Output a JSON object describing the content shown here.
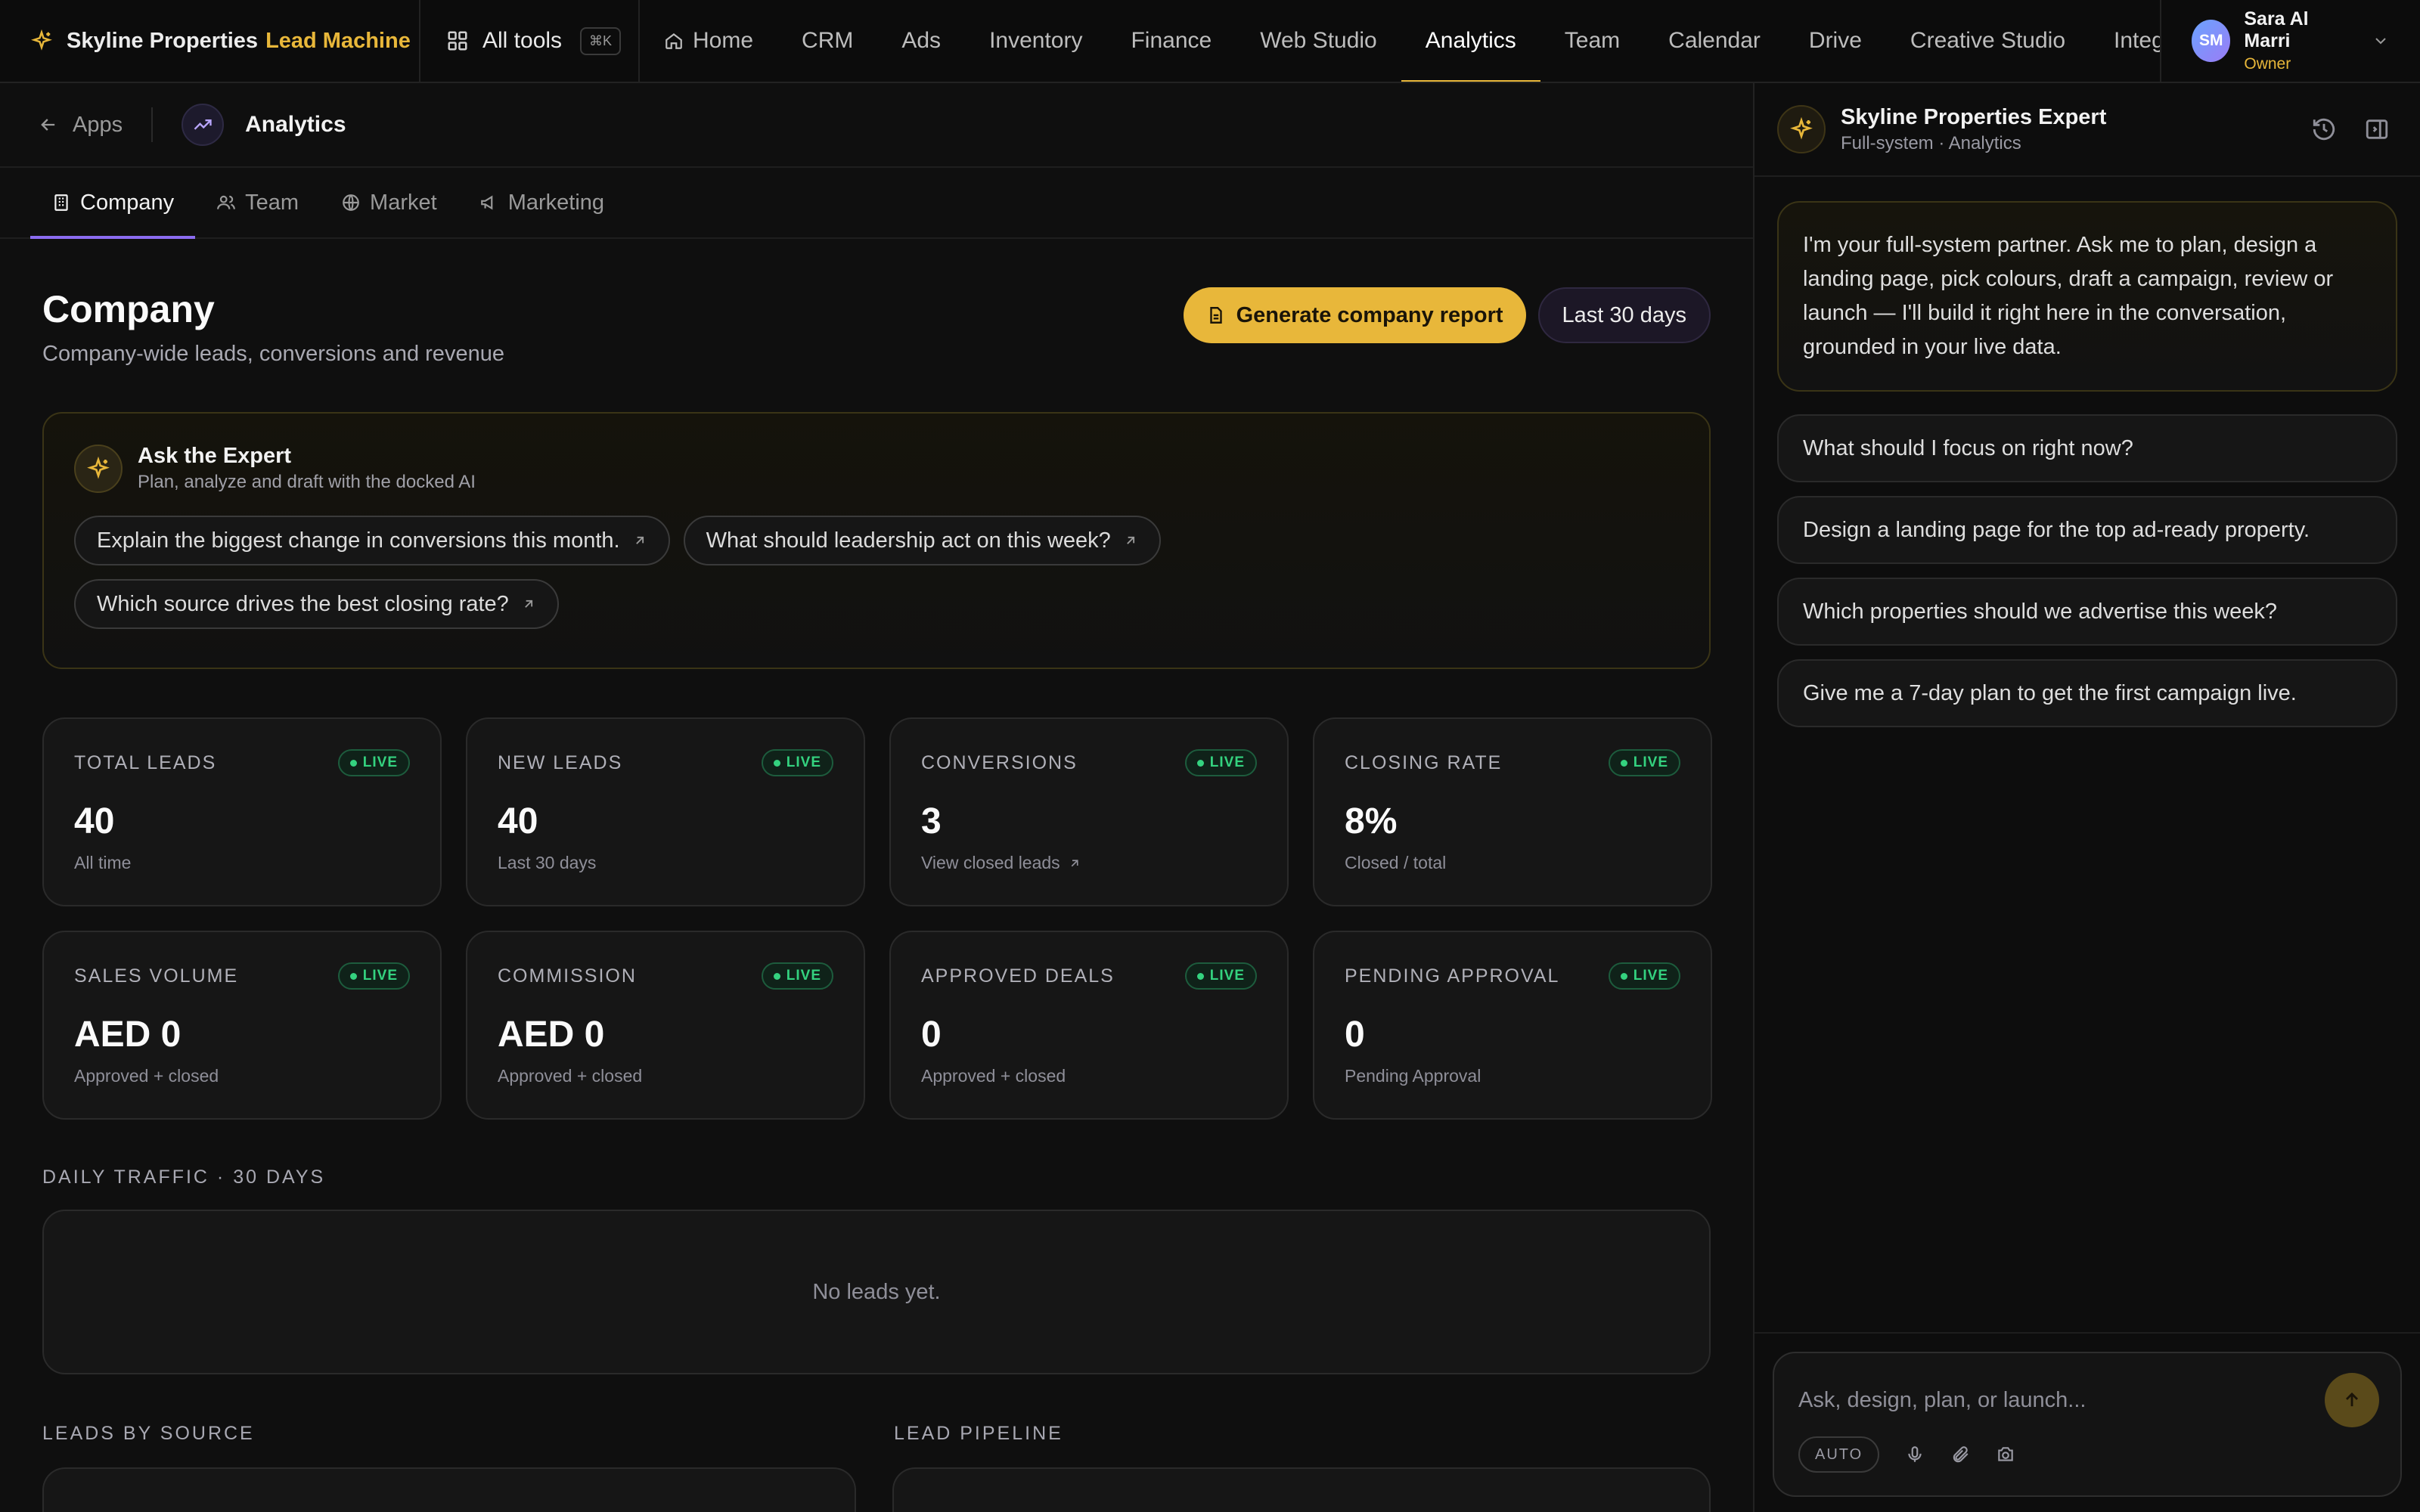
{
  "brand": {
    "name": "Skyline Properties",
    "product": "Lead Machine"
  },
  "topnav": {
    "all_tools_label": "All tools",
    "shortcut": "⌘K",
    "links": [
      {
        "label": "Home"
      },
      {
        "label": "CRM"
      },
      {
        "label": "Ads"
      },
      {
        "label": "Inventory"
      },
      {
        "label": "Finance"
      },
      {
        "label": "Web Studio"
      },
      {
        "label": "Analytics"
      },
      {
        "label": "Team"
      },
      {
        "label": "Calendar"
      },
      {
        "label": "Drive"
      },
      {
        "label": "Creative Studio"
      },
      {
        "label": "Integ"
      }
    ],
    "active": "Analytics"
  },
  "user": {
    "initials": "SM",
    "name": "Sara Al Marri",
    "role": "Owner"
  },
  "breadcrumb": {
    "back_label": "Apps",
    "app_title": "Analytics"
  },
  "tabs": [
    {
      "label": "Company"
    },
    {
      "label": "Team"
    },
    {
      "label": "Market"
    },
    {
      "label": "Marketing"
    }
  ],
  "page": {
    "title": "Company",
    "subtitle": "Company-wide leads, conversions and revenue",
    "report_button": "Generate company report",
    "range_button": "Last 30 days"
  },
  "expert": {
    "title": "Ask the Expert",
    "subtitle": "Plan, analyze and draft with the docked AI",
    "chips": [
      "Explain the biggest change in conversions this month.",
      "What should leadership act on this week?",
      "Which source drives the best closing rate?"
    ]
  },
  "live_label": "LIVE",
  "stats": [
    {
      "label": "TOTAL LEADS",
      "value": "40",
      "note": "All time"
    },
    {
      "label": "NEW LEADS",
      "value": "40",
      "note": "Last 30 days"
    },
    {
      "label": "CONVERSIONS",
      "value": "3",
      "note": "View closed leads"
    },
    {
      "label": "CLOSING RATE",
      "value": "8%",
      "note": "Closed / total"
    },
    {
      "label": "SALES VOLUME",
      "value": "AED 0",
      "note": "Approved + closed"
    },
    {
      "label": "COMMISSION",
      "value": "AED 0",
      "note": "Approved + closed"
    },
    {
      "label": "APPROVED DEALS",
      "value": "0",
      "note": "Approved + closed"
    },
    {
      "label": "PENDING APPROVAL",
      "value": "0",
      "note": "Pending Approval"
    }
  ],
  "traffic": {
    "label": "DAILY TRAFFIC · 30 DAYS",
    "empty": "No leads yet."
  },
  "sections": {
    "by_source": "LEADS BY SOURCE",
    "pipeline": "LEAD PIPELINE"
  },
  "assistant": {
    "title": "Skyline Properties Expert",
    "subtitle": "Full-system · Analytics",
    "intro": "I'm your full-system partner. Ask me to plan, design a landing page, pick colours, draft a campaign, review or launch — I'll build it right here in the conversation, grounded in your live data.",
    "suggestions": [
      "What should I focus on right now?",
      "Design a landing page for the top ad-ready property.",
      "Which properties should we advertise this week?",
      "Give me a 7-day plan to get the first campaign live."
    ],
    "input_placeholder": "Ask, design, plan, or launch...",
    "mode": "AUTO"
  },
  "colors": {
    "accent": "#e8b73a",
    "tab_underline": "#8b6cf0",
    "live": "#34d27f"
  }
}
